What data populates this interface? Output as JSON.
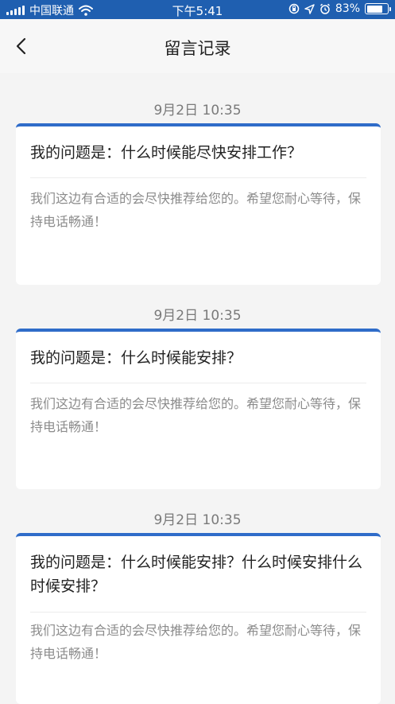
{
  "status_bar": {
    "carrier": "中国联通",
    "time": "下午5:41",
    "battery_percent": "83%",
    "battery_level": 0.83
  },
  "nav": {
    "title": "留言记录"
  },
  "records": [
    {
      "date": "9月2日 10:35",
      "question": "我的问题是：什么时候能尽快安排工作？",
      "answer": "我们这边有合适的会尽快推荐给您的。希望您耐心等待，保持电话畅通！"
    },
    {
      "date": "9月2日 10:35",
      "question": "我的问题是：什么时候能安排？",
      "answer": "我们这边有合适的会尽快推荐给您的。希望您耐心等待，保持电话畅通！"
    },
    {
      "date": "9月2日 10:35",
      "question": "我的问题是：什么时候能安排？什么时候安排什么时候安排？",
      "answer": "我们这边有合适的会尽快推荐给您的。希望您耐心等待，保持电话畅通！"
    }
  ],
  "colors": {
    "status_bar_bg": "#1f5fb0",
    "card_accent": "#2f6cc9"
  }
}
